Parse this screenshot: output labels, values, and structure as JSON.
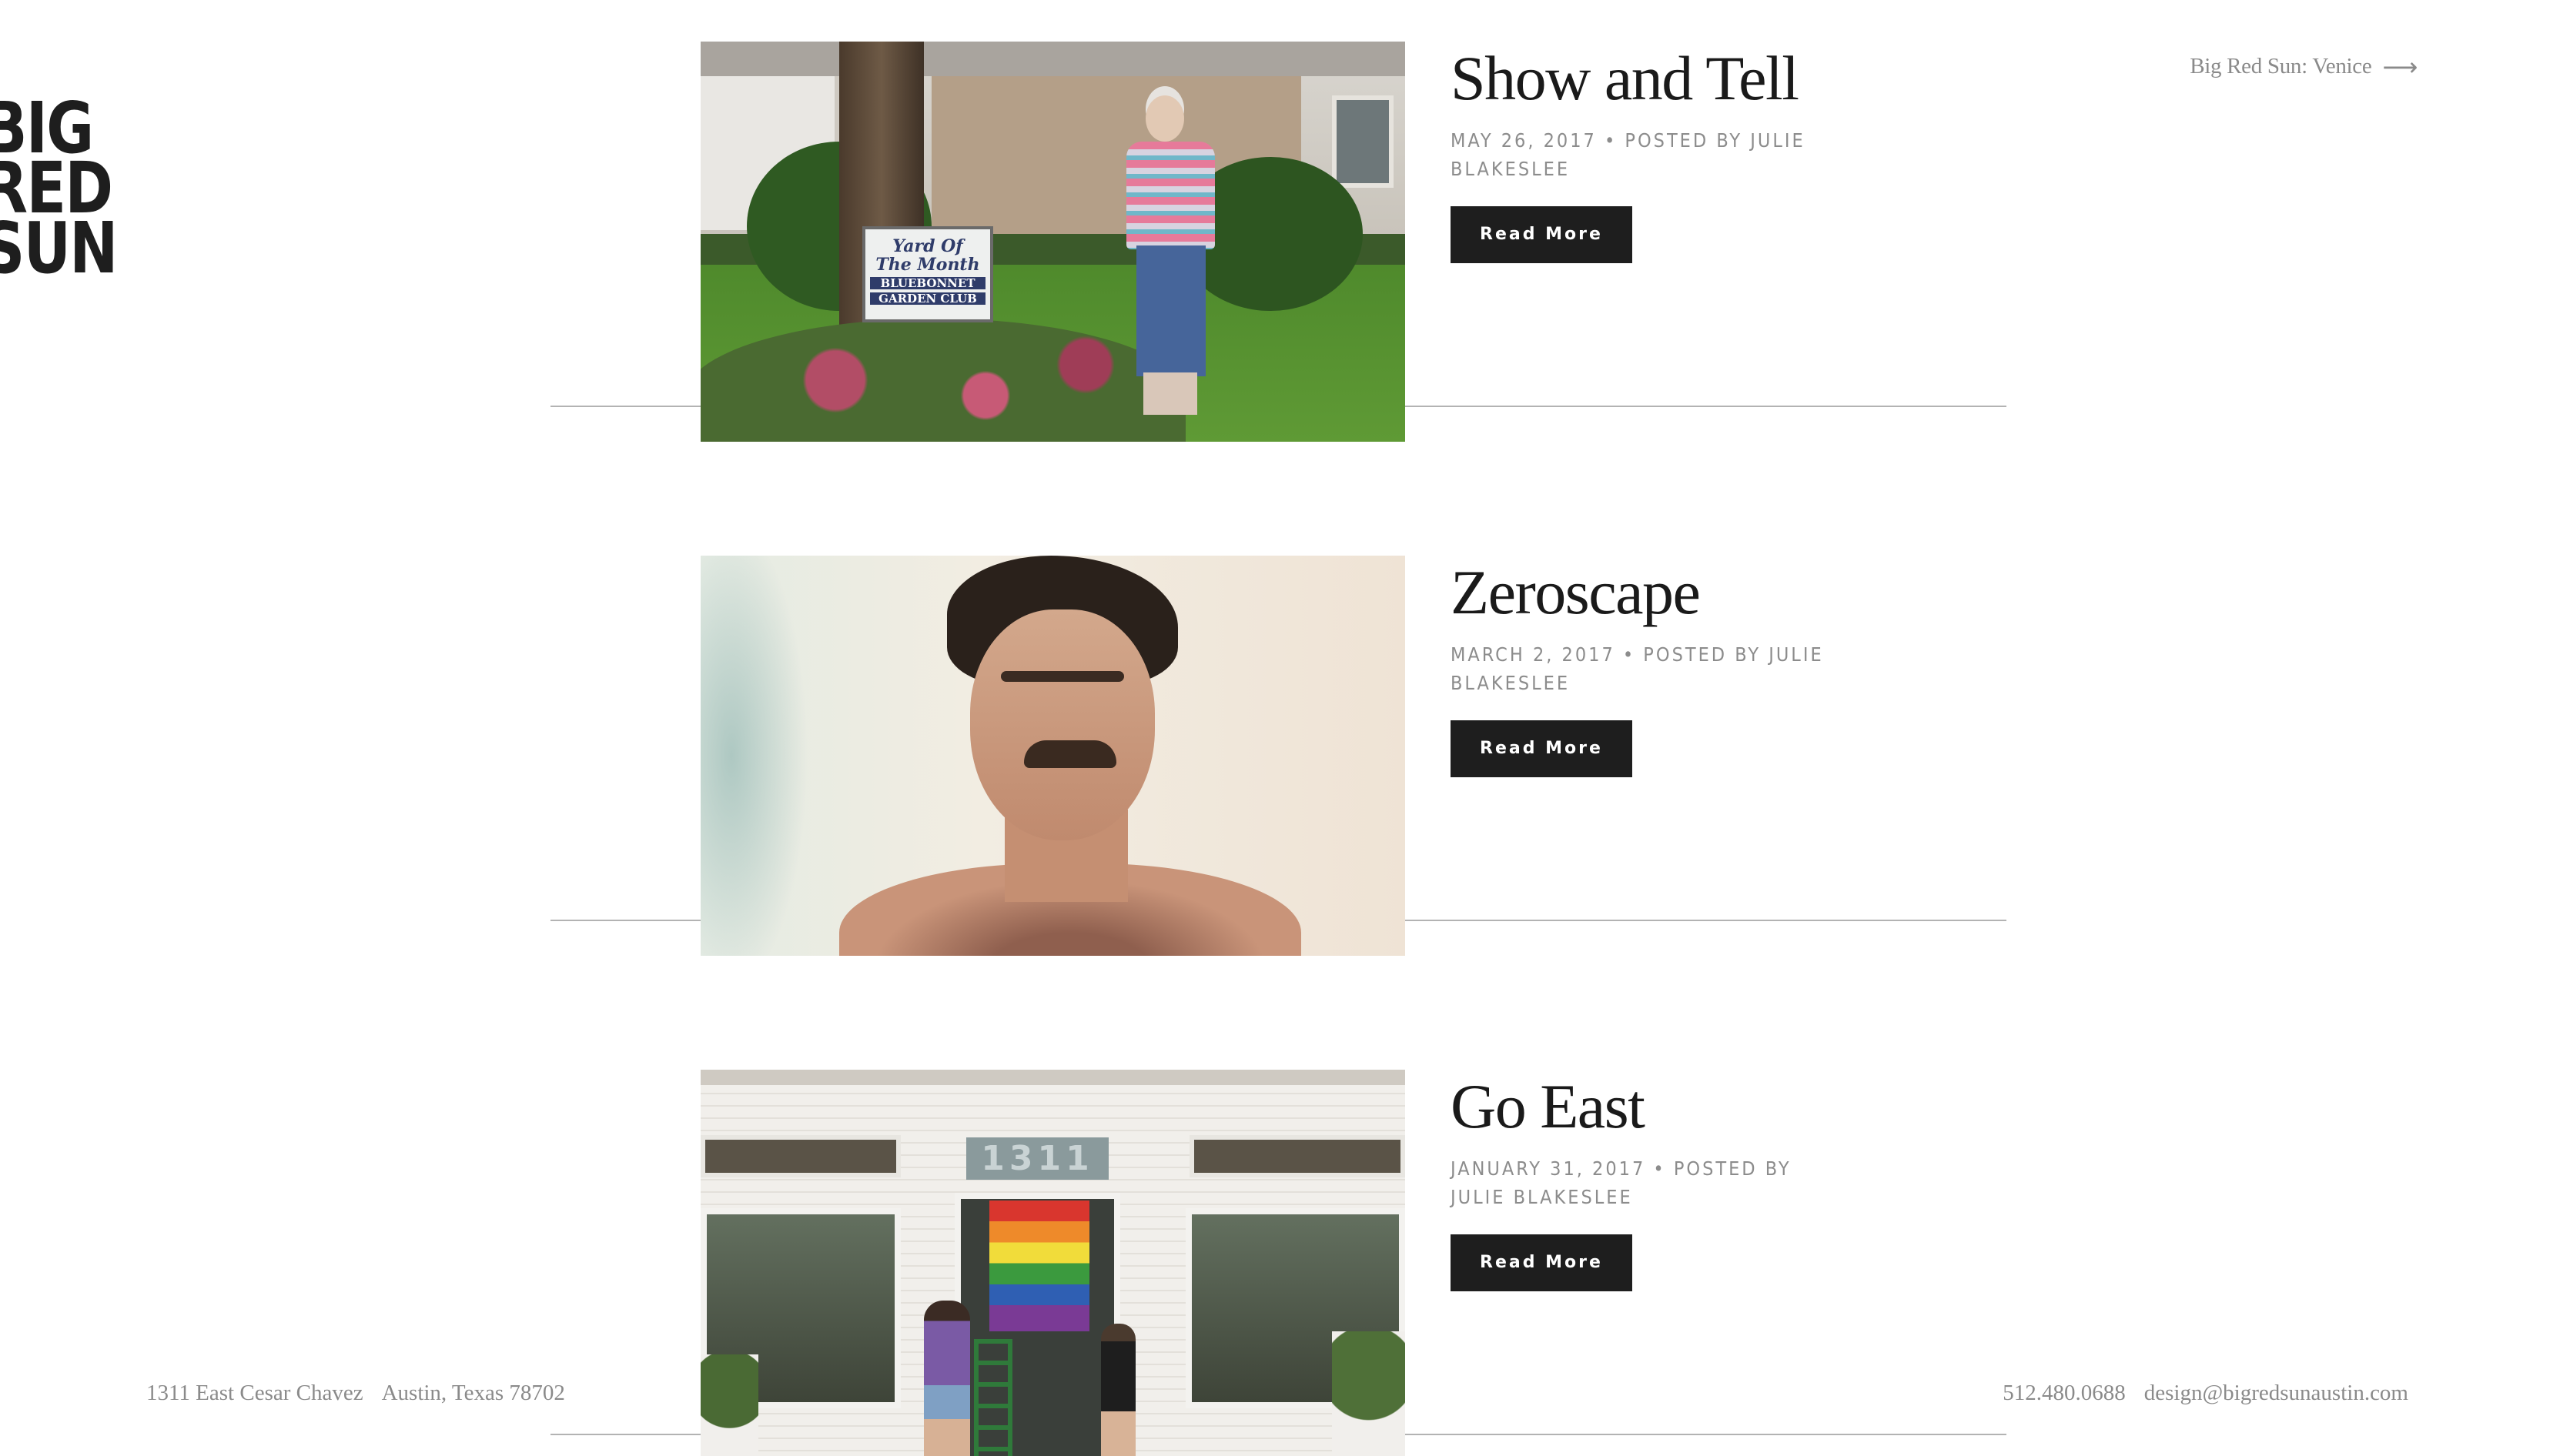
{
  "logo": {
    "lines": [
      "BIG",
      "RED",
      "SUN"
    ]
  },
  "header": {
    "venice_link": "Big Red Sun: Venice",
    "arrow_icon": "long-arrow-right-icon"
  },
  "posts": [
    {
      "title": "Show and Tell",
      "meta": "May 26, 2017 • Posted by Julie Blakeslee",
      "button": "Read More",
      "image_sign": {
        "line1": "Yard Of",
        "line2": "The Month",
        "line3": "BLUEBONNET",
        "line4": "GARDEN CLUB"
      }
    },
    {
      "title": "Zeroscape",
      "meta": "March 2, 2017 • Posted by Julie Blakeslee",
      "button": "Read More"
    },
    {
      "title": "Go East",
      "meta": "January 31, 2017 • Posted by Julie Blakeslee",
      "button": "Read More",
      "building_number": "1311"
    }
  ],
  "footer": {
    "street": "1311 East Cesar Chavez",
    "city": "Austin, Texas 78702",
    "phone": "512.480.0688",
    "email": "design@bigredsunaustin.com"
  }
}
